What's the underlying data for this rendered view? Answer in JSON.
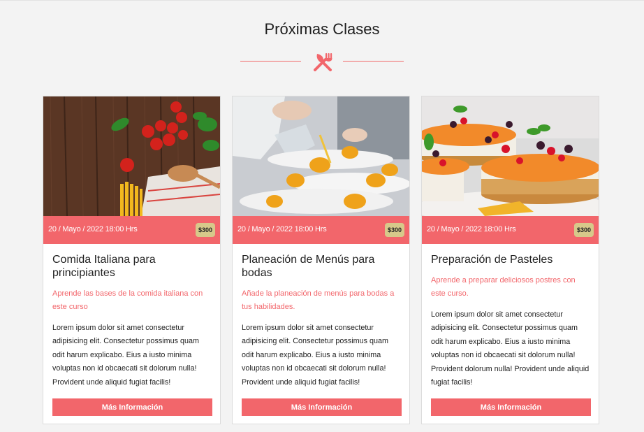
{
  "section": {
    "title": "Próximas Clases",
    "divider_icon": "utensils-icon",
    "accent_color": "#f2666b",
    "price_badge_color": "#d7c98a"
  },
  "cards": [
    {
      "image": "italian-ingredients-photo",
      "date": "20 / Mayo / 2022 18:00 Hrs",
      "price": "$300",
      "title": "Comida Italiana para principiantes",
      "subtitle": "Aprende las bases de la comida italiana con este curso",
      "description": "Lorem ipsum dolor sit amet consectetur adipisicing elit. Consectetur possimus quam odit harum explicabo. Eius a iusto minima voluptas non id obcaecati sit dolorum nulla! Provident unde aliquid fugiat facilis!",
      "button": "Más Información"
    },
    {
      "image": "chef-plating-photo",
      "date": "20 / Mayo / 2022 18:00 Hrs",
      "price": "$300",
      "title": "Planeación de Menús para bodas",
      "subtitle": "Añade la planeación de menús para bodas a tus habilidades.",
      "description": "Lorem ipsum dolor sit amet consectetur adipisicing elit. Consectetur possimus quam odit harum explicabo. Eius a iusto minima voluptas non id obcaecati sit dolorum nulla! Provident unde aliquid fugiat facilis!",
      "button": "Más Información"
    },
    {
      "image": "cheesecake-photo",
      "date": "20 / Mayo / 2022 18:00 Hrs",
      "price": "$300",
      "title": "Preparación de Pasteles",
      "subtitle": "Aprende a preparar deliciosos postres con este curso.",
      "description": "Lorem ipsum dolor sit amet consectetur adipisicing elit. Consectetur possimus quam odit harum explicabo. Eius a iusto minima voluptas non id obcaecati sit dolorum nulla! Provident dolorum nulla! Provident unde aliquid fugiat facilis!",
      "button": "Más Información"
    }
  ]
}
